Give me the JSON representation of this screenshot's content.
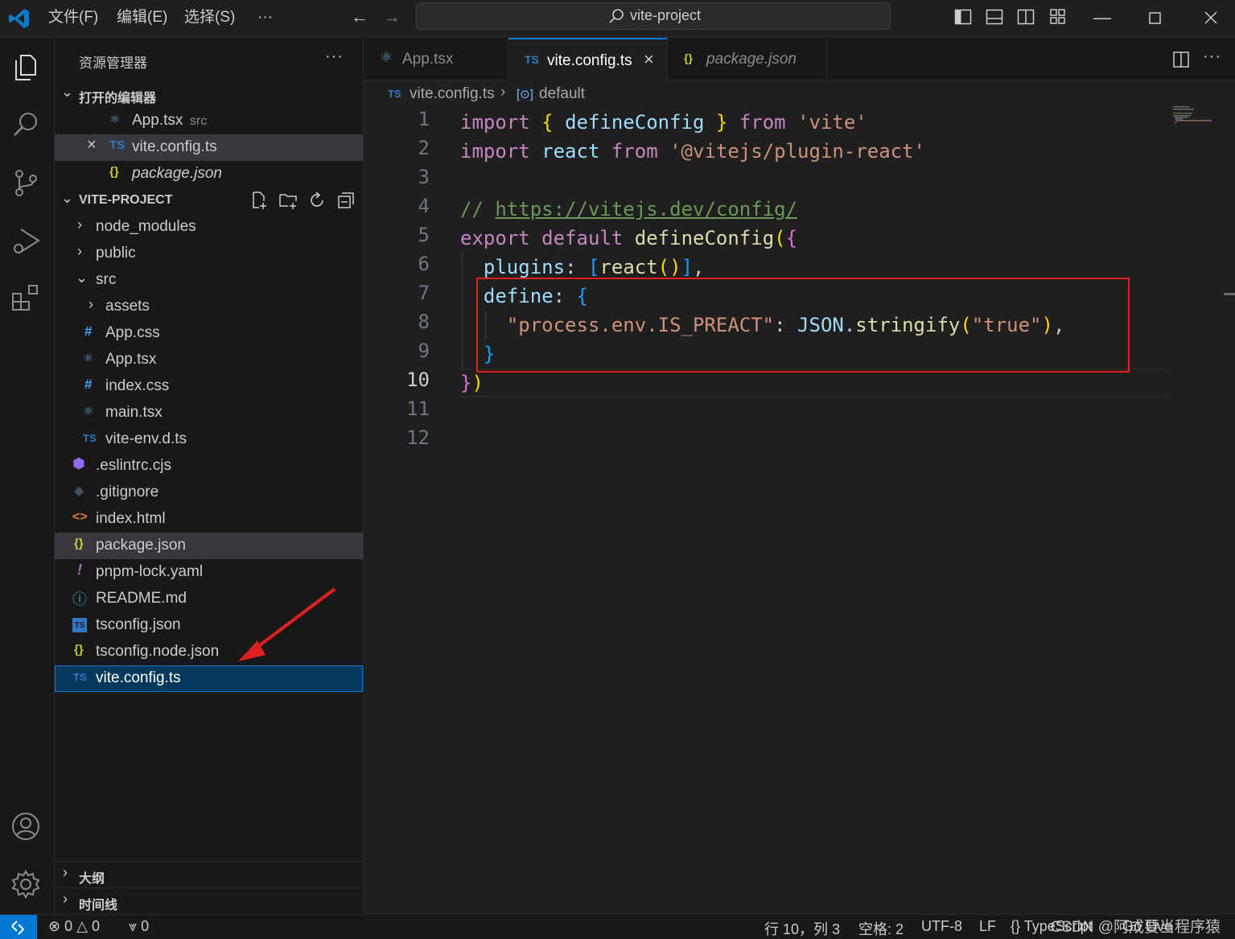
{
  "titlebar": {
    "menu": [
      "文件(F)",
      "编辑(E)",
      "选择(S)",
      "···"
    ],
    "search_text": "vite-project",
    "back_icon": "arrow-left-icon",
    "forward_icon": "arrow-right-icon",
    "window_controls": [
      "minimize",
      "maximize",
      "close"
    ]
  },
  "activitybar": {
    "items": [
      "explorer-icon",
      "search-icon",
      "source-control-icon",
      "run-debug-icon",
      "extensions-icon"
    ],
    "bottom": [
      "accounts-icon",
      "manage-gear-icon"
    ]
  },
  "sidebar": {
    "title": "资源管理器",
    "more": "···",
    "open_editors": {
      "header": "打开的编辑器",
      "items": [
        {
          "name": "App.tsx",
          "desc": "src",
          "icon": "react-icon"
        },
        {
          "name": "vite.config.ts",
          "desc": "",
          "icon": "TS"
        },
        {
          "name": "package.json",
          "desc": "",
          "icon": "{}"
        }
      ]
    },
    "project": {
      "header": "VITE-PROJECT",
      "tree": {
        "node_modules": "node_modules",
        "public": "public",
        "src": "src",
        "assets": "assets",
        "app_css": "App.css",
        "app_tsx": "App.tsx",
        "index_css": "index.css",
        "main_tsx": "main.tsx",
        "vite_env": "vite-env.d.ts",
        "eslintrc": ".eslintrc.cjs",
        "gitignore": ".gitignore",
        "index_html": "index.html",
        "package_json": "package.json",
        "pnpm_lock": "pnpm-lock.yaml",
        "readme": "README.md",
        "tsconfig": "tsconfig.json",
        "tsconfig_node": "tsconfig.node.json",
        "vite_config": "vite.config.ts"
      }
    },
    "outline": "大纲",
    "timeline": "时间线"
  },
  "tabs": [
    {
      "label": "App.tsx",
      "icon": "react-icon"
    },
    {
      "label": "vite.config.ts",
      "icon": "TS",
      "close": "×"
    },
    {
      "label": "package.json",
      "icon": "{}"
    }
  ],
  "breadcrumbs": {
    "file": "vite.config.ts",
    "symbol": "default"
  },
  "editor": {
    "line_numbers": [
      "1",
      "2",
      "3",
      "4",
      "5",
      "6",
      "7",
      "8",
      "9",
      "10",
      "11",
      "12"
    ],
    "current_line": "10",
    "code": {
      "l1": {
        "import": "import",
        "ob": "{",
        "name": "defineConfig",
        "cb": "}",
        "from": "from",
        "src": "'vite'"
      },
      "l2": {
        "import": "import",
        "name": "react",
        "from": "from",
        "src": "'@vitejs/plugin-react'"
      },
      "l4": {
        "slashes": "//",
        "url": "https://vitejs.dev/config/"
      },
      "l5": {
        "export": "export",
        "default": "default",
        "fn": "defineConfig",
        "p": "(",
        "b": "{"
      },
      "l6": {
        "key": "plugins",
        "colon": ":",
        "ob": "[",
        "fn": "react",
        "pp": "()",
        "cb": "]",
        "comma": ","
      },
      "l7": {
        "key": "define",
        "colon": ":",
        "b": "{"
      },
      "l8": {
        "key": "\"process.env.IS_PREACT\"",
        "colon": ":",
        "obj": "JSON",
        "dot": ".",
        "fn": "stringify",
        "op": "(",
        "arg": "\"true\"",
        "cp": ")",
        "comma": ","
      },
      "l9": {
        "b": "}"
      },
      "l10": {
        "b": "}",
        "p": ")"
      }
    }
  },
  "statusbar": {
    "errors": "0",
    "warnings": "0",
    "ports": "0",
    "position": "行 10，列 3",
    "spaces": "空格: 2",
    "encoding": "UTF-8",
    "eol": "LF",
    "language": "{} TypeScript",
    "golive": "Go Live",
    "watermark": "CSDN @阿成要当程序猿"
  },
  "colors": {
    "accent": "#0078d4",
    "annotation": "#e02020",
    "ts_icon": "#3178c6",
    "json_icon": "#cbcb41",
    "react_icon": "#519aba"
  }
}
